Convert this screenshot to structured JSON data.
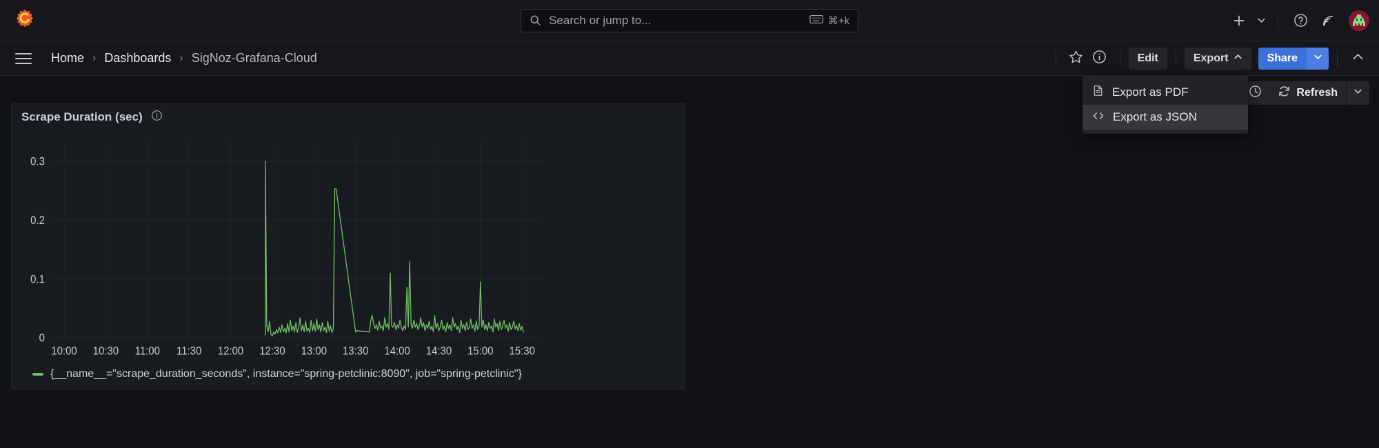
{
  "topnav": {
    "logo_icon": "grafana-logo-icon",
    "search": {
      "placeholder": "Search or jump to...",
      "icon": "search-icon",
      "kbd_icon": "keyboard-icon",
      "shortcut": "⌘+k"
    },
    "add_label": "+",
    "add_icon": "plus-icon",
    "add_chevron_icon": "chevron-down-icon",
    "help_icon": "help-circle-icon",
    "news_icon": "rss-feed-icon",
    "avatar_icon": "user-avatar-icon"
  },
  "subnav": {
    "menu_icon": "hamburger-menu-icon",
    "breadcrumbs": [
      {
        "label": "Home"
      },
      {
        "label": "Dashboards"
      },
      {
        "label": "SigNoz-Grafana-Cloud"
      }
    ],
    "separator": "›",
    "star_icon": "star-outline-icon",
    "info_icon": "info-circle-icon",
    "edit_label": "Edit",
    "export_label": "Export",
    "export_chevron_icon": "chevron-up-icon",
    "share_label": "Share",
    "share_chevron_icon": "chevron-down-icon",
    "collapse_icon": "chevron-up-icon"
  },
  "export_menu": {
    "items": [
      {
        "label": "Export as PDF",
        "icon": "file-document-icon",
        "active": false
      },
      {
        "label": "Export as JSON",
        "icon": "code-brackets-icon",
        "active": true
      }
    ]
  },
  "timebar": {
    "time_picker_icon": "clock-icon",
    "refresh_label": "Refresh",
    "refresh_icon": "refresh-sync-icon",
    "refresh_chevron_icon": "chevron-down-icon"
  },
  "panel": {
    "title": "Scrape Duration (sec)",
    "info_icon": "info-circle-icon",
    "legend_label": "{__name__=\"scrape_duration_seconds\", instance=\"spring-petclinic:8090\", job=\"spring-petclinic\"}",
    "series_color": "#73bf69"
  },
  "chart_data": {
    "type": "line",
    "title": "Scrape Duration (sec)",
    "xlabel": "",
    "ylabel": "",
    "grid": true,
    "legend_position": "bottom",
    "ylim": [
      0,
      0.335
    ],
    "yticks": [
      0,
      0.1,
      0.2,
      0.3
    ],
    "ytick_labels": [
      "0",
      "0.1",
      "0.2",
      "0.3"
    ],
    "xlim": [
      "09:50",
      "15:45"
    ],
    "xticks": [
      "10:00",
      "10:30",
      "11:00",
      "11:30",
      "12:00",
      "12:30",
      "13:00",
      "13:30",
      "14:00",
      "14:30",
      "15:00",
      "15:30"
    ],
    "series": [
      {
        "name": "{__name__=\"scrape_duration_seconds\", instance=\"spring-petclinic:8090\", job=\"spring-petclinic\"}",
        "color": "#73bf69",
        "data_start": "12:25",
        "x": [
          "12:25",
          "12:25",
          "12:26",
          "12:27",
          "12:28",
          "12:29",
          "12:30",
          "12:31",
          "12:32",
          "12:33",
          "12:34",
          "12:35",
          "12:36",
          "12:37",
          "12:38",
          "12:39",
          "12:40",
          "12:41",
          "12:42",
          "12:43",
          "12:44",
          "12:45",
          "12:46",
          "12:47",
          "12:48",
          "12:49",
          "12:50",
          "12:51",
          "12:52",
          "12:53",
          "12:54",
          "12:55",
          "12:56",
          "12:57",
          "12:58",
          "12:59",
          "13:00",
          "13:01",
          "13:02",
          "13:03",
          "13:04",
          "13:05",
          "13:06",
          "13:07",
          "13:08",
          "13:09",
          "13:10",
          "13:11",
          "13:12",
          "13:13",
          "13:14",
          "13:15",
          "13:16",
          "13:30",
          "13:31",
          "13:40",
          "13:41",
          "13:42",
          "13:43",
          "13:44",
          "13:45",
          "13:46",
          "13:47",
          "13:48",
          "13:49",
          "13:50",
          "13:51",
          "13:52",
          "13:53",
          "13:54",
          "13:55",
          "13:56",
          "13:57",
          "13:58",
          "13:59",
          "14:00",
          "14:01",
          "14:02",
          "14:03",
          "14:04",
          "14:05",
          "14:06",
          "14:07",
          "14:08",
          "14:09",
          "14:10",
          "14:11",
          "14:12",
          "14:13",
          "14:14",
          "14:15",
          "14:16",
          "14:17",
          "14:18",
          "14:19",
          "14:20",
          "14:21",
          "14:22",
          "14:23",
          "14:24",
          "14:25",
          "14:26",
          "14:27",
          "14:28",
          "14:29",
          "14:30",
          "14:31",
          "14:32",
          "14:33",
          "14:34",
          "14:35",
          "14:36",
          "14:37",
          "14:38",
          "14:39",
          "14:40",
          "14:41",
          "14:42",
          "14:43",
          "14:44",
          "14:45",
          "14:46",
          "14:47",
          "14:48",
          "14:49",
          "14:50",
          "14:51",
          "14:52",
          "14:53",
          "14:54",
          "14:55",
          "14:56",
          "14:57",
          "14:58",
          "14:59",
          "15:00",
          "15:01",
          "15:02",
          "15:03",
          "15:04",
          "15:05",
          "15:06",
          "15:07",
          "15:08",
          "15:09",
          "15:10",
          "15:11",
          "15:12",
          "15:13",
          "15:14",
          "15:15",
          "15:16",
          "15:17",
          "15:18",
          "15:19",
          "15:20",
          "15:21",
          "15:22",
          "15:23",
          "15:24",
          "15:25",
          "15:26",
          "15:27",
          "15:28",
          "15:29",
          "15:30",
          "15:31",
          "15:32",
          "15:33",
          "15:34"
        ],
        "y": [
          0.005,
          0.3,
          0.02,
          0.01,
          0.028,
          0.006,
          0.003,
          0.01,
          0.006,
          0.014,
          0.008,
          0.018,
          0.009,
          0.022,
          0.01,
          0.016,
          0.008,
          0.024,
          0.01,
          0.03,
          0.012,
          0.02,
          0.01,
          0.026,
          0.009,
          0.018,
          0.034,
          0.012,
          0.022,
          0.01,
          0.028,
          0.011,
          0.016,
          0.009,
          0.03,
          0.012,
          0.024,
          0.011,
          0.032,
          0.013,
          0.022,
          0.01,
          0.026,
          0.012,
          0.018,
          0.009,
          0.028,
          0.011,
          0.02,
          0.009,
          0.016,
          0.253,
          0.253,
          0.01,
          0.012,
          0.01,
          0.03,
          0.038,
          0.024,
          0.016,
          0.022,
          0.013,
          0.028,
          0.016,
          0.02,
          0.012,
          0.034,
          0.018,
          0.024,
          0.014,
          0.11,
          0.02,
          0.018,
          0.026,
          0.014,
          0.022,
          0.016,
          0.03,
          0.018,
          0.012,
          0.02,
          0.014,
          0.086,
          0.018,
          0.129,
          0.022,
          0.016,
          0.03,
          0.018,
          0.024,
          0.014,
          0.02,
          0.034,
          0.018,
          0.026,
          0.012,
          0.022,
          0.016,
          0.028,
          0.014,
          0.02,
          0.01,
          0.038,
          0.016,
          0.024,
          0.012,
          0.018,
          0.03,
          0.014,
          0.02,
          0.01,
          0.026,
          0.016,
          0.022,
          0.012,
          0.034,
          0.018,
          0.024,
          0.014,
          0.02,
          0.009,
          0.03,
          0.016,
          0.022,
          0.012,
          0.026,
          0.014,
          0.018,
          0.032,
          0.016,
          0.022,
          0.011,
          0.028,
          0.014,
          0.02,
          0.095,
          0.018,
          0.03,
          0.014,
          0.022,
          0.012,
          0.026,
          0.016,
          0.02,
          0.01,
          0.032,
          0.018,
          0.024,
          0.012,
          0.028,
          0.014,
          0.02,
          0.03,
          0.016,
          0.022,
          0.011,
          0.026,
          0.014,
          0.018,
          0.028,
          0.015,
          0.021,
          0.012,
          0.024,
          0.013,
          0.019,
          0.01
        ]
      }
    ]
  }
}
